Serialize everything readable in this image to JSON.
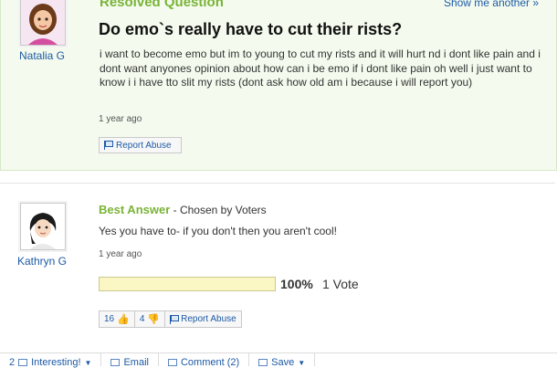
{
  "question": {
    "status": "Resolved Question",
    "show_another": "Show me another »",
    "asker_name": "Natalia G",
    "title": "Do emo`s really have to cut their rists?",
    "body": "i want to become emo but im to young to cut my rists and it will hurt nd i dont like pain and i dont want anyones opinion about how can i be emo if i dont like pain oh well i just want to know i i have tto slit my rists (dont ask how old am i because i will report you)",
    "timestamp": "1 year ago",
    "report_abuse": "Report Abuse"
  },
  "answer": {
    "best_label": "Best Answer",
    "chosen_by": " - Chosen by Voters",
    "answerer_name": "Kathryn G",
    "text": "Yes you have to- if you don't then you aren't cool!",
    "timestamp": "1 year ago",
    "vote_fraction": 1.0,
    "vote_percent": "100%",
    "vote_count": "1 Vote",
    "thumbs_up": "16",
    "thumbs_down": "4",
    "report_abuse": "Report Abuse"
  },
  "actions": {
    "interesting_count": "2",
    "interesting": "Interesting!",
    "email": "Email",
    "comment": "Comment (2)",
    "save": "Save"
  },
  "colors": {
    "accent_green": "#79b337",
    "link_blue": "#1d5aa6",
    "panel_bg": "#f4fbee"
  }
}
